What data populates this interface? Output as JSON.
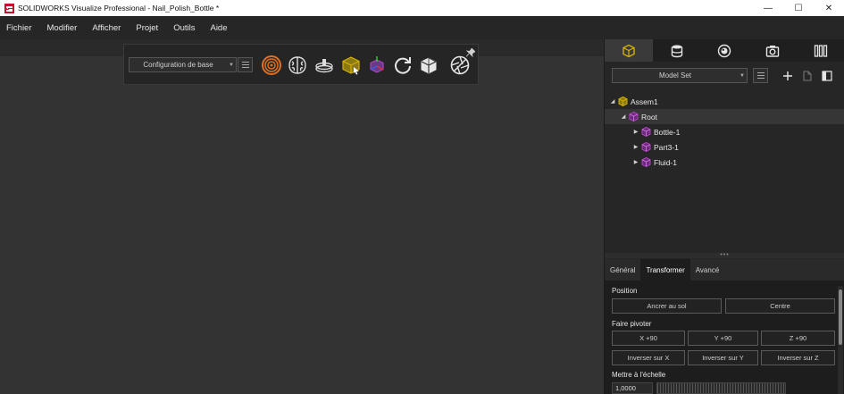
{
  "window": {
    "title": "SOLIDWORKS Visualize Professional - Nail_Polish_Bottle *",
    "minimize_glyph": "—",
    "maximize_glyph": "☐",
    "close_glyph": "✕"
  },
  "menu": {
    "items": [
      "Fichier",
      "Modifier",
      "Afficher",
      "Projet",
      "Outils",
      "Aide"
    ]
  },
  "toolbar": {
    "configuration_value": "Configuration de base",
    "icons": [
      "render-target-icon",
      "brain-icon",
      "turntable-icon",
      "cube-select-icon",
      "pivot-cube-icon",
      "refresh-icon",
      "wireframe-cube-icon",
      "camera-aperture-icon",
      "pin-icon"
    ]
  },
  "right_panel": {
    "tabs": [
      "models-tab",
      "appearances-tab",
      "scenes-tab",
      "cameras-tab",
      "libraries-tab"
    ],
    "model_set_value": "Model Set",
    "tree": [
      {
        "label": "Assem1",
        "expanded": true,
        "color": "#d4b000"
      },
      {
        "label": "Root",
        "expanded": true,
        "color": "#b040c0",
        "selected": true
      },
      {
        "label": "Bottle-1",
        "expanded": false,
        "color": "#b040c0"
      },
      {
        "label": "Part3-1",
        "expanded": false,
        "color": "#b040c0"
      },
      {
        "label": "Fluid-1",
        "expanded": false,
        "color": "#b040c0"
      }
    ]
  },
  "properties": {
    "tabs": [
      "Général",
      "Transformer",
      "Avancé"
    ],
    "active_tab": "Transformer",
    "position_label": "Position",
    "ancrer_label": "Ancrer au sol",
    "centre_label": "Centre",
    "pivot_label": "Faire pivoter",
    "rot_x": "X +90",
    "rot_y": "Y +90",
    "rot_z": "Z +90",
    "inv_x": "Inverser sur X",
    "inv_y": "Inverser sur Y",
    "inv_z": "Inverser sur Z",
    "scale_label": "Mettre à l'échelle",
    "scale_value": "1,0000"
  },
  "colors": {
    "accent_yellow": "#d4b000",
    "part_magenta": "#b040c0",
    "render_orange": "#e07020"
  }
}
